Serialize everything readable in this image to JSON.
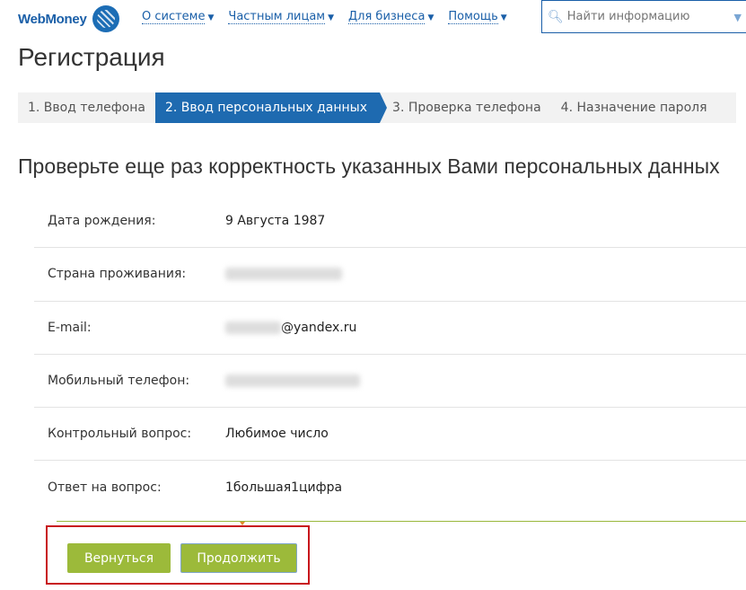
{
  "header": {
    "logo": "WebMoney",
    "nav": [
      "О системе",
      "Частным лицам",
      "Для бизнеса",
      "Помощь"
    ],
    "search_placeholder": "Найти информацию"
  },
  "title": "Регистрация",
  "steps": [
    "1. Ввод телефона",
    "2. Ввод персональных данных",
    "3. Проверка телефона",
    "4. Назначение пароля"
  ],
  "subtitle": "Проверьте еще раз корректность указанных Вами персональных данных",
  "fields": [
    {
      "label": "Дата рождения:",
      "value": "9 Августа 1987"
    },
    {
      "label": "Страна проживания:",
      "value": ""
    },
    {
      "label": "E-mail:",
      "value": "@yandex.ru"
    },
    {
      "label": "Мобильный телефон:",
      "value": ""
    },
    {
      "label": "Контрольный вопрос:",
      "value": "Любимое число"
    },
    {
      "label": "Ответ на вопрос:",
      "value": "1большая1цифра"
    }
  ],
  "buttons": {
    "back": "Вернуться",
    "continue": "Продолжить"
  }
}
